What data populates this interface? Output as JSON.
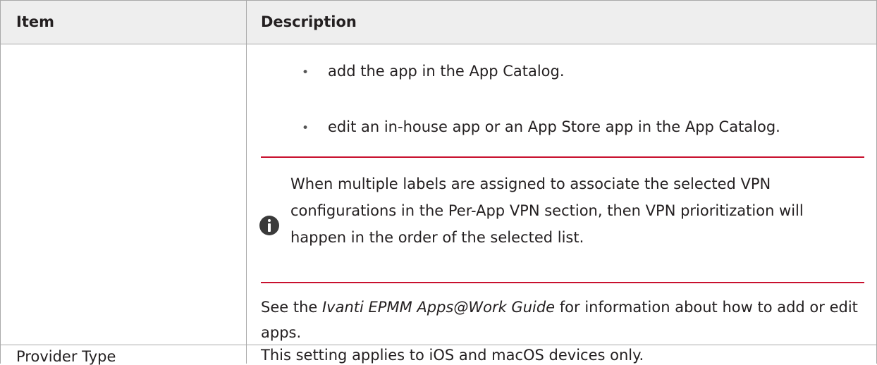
{
  "table": {
    "headers": {
      "item": "Item",
      "description": "Description"
    },
    "row1": {
      "bullets": [
        "add the app in the App Catalog.",
        "edit an in-house app or an App Store app in the App Catalog."
      ],
      "bullet_glyph": "•",
      "note": {
        "icon": "info-icon",
        "text": "When multiple labels are assigned to associate the selected VPN configurations in the Per-App VPN section, then VPN prioritization will happen in the order of the selected list.",
        "rule_color": "#c8102e"
      },
      "see_also": {
        "prefix": "See the ",
        "guide_title": "Ivanti EPMM Apps@Work Guide",
        "suffix": " for information about how to add or edit apps."
      }
    },
    "row2": {
      "item": "Provider Type",
      "description": "This setting applies to iOS and macOS devices only."
    }
  },
  "colors": {
    "header_background": "#eeeeee",
    "border": "#a9a9a9",
    "text": "#231f20",
    "accent_rule": "#c8102e",
    "icon_fill": "#3a3a3a"
  }
}
